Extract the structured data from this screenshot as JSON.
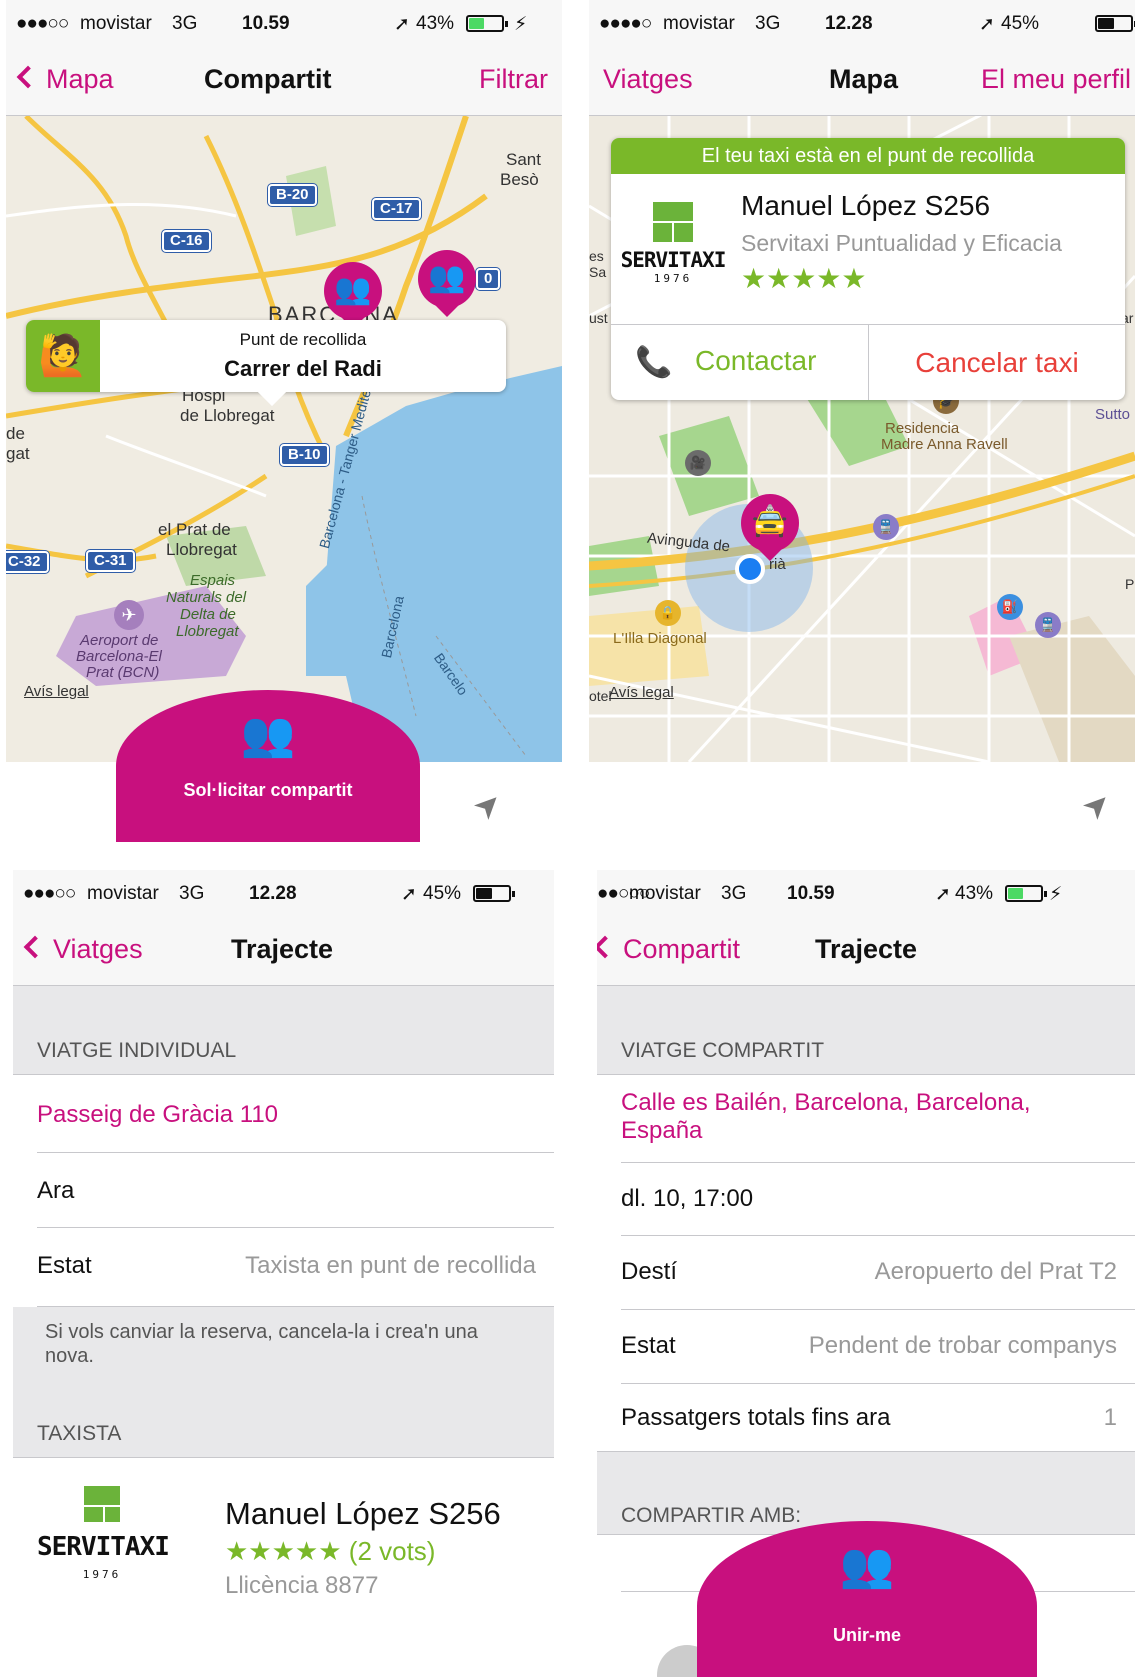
{
  "panel1": {
    "status": {
      "signal": "●●●○○",
      "carrier": "movistar",
      "network": "3G",
      "time": "10.59",
      "battery": "43%"
    },
    "nav": {
      "back": "Mapa",
      "title": "Compartit",
      "right": "Filtrar"
    },
    "map": {
      "labels": {
        "sant": "Sant",
        "beso": "Besò",
        "hosp": "Hospi",
        "de_llobregat": "de Llobregat",
        "de": "de",
        "gat": "gat",
        "prat": "el Prat de",
        "llobregat": "Llobregat",
        "espais": "Espais",
        "naturals": "Naturals del",
        "delta": "Delta de",
        "llob2": "Llobregat",
        "aero1": "Aeroport de",
        "aero2": "Barcelona-El",
        "aero3": "Prat (BCN)",
        "tanger": "Barcelona - Tanger Mediterraneo",
        "barcelona_road": "Barcelona",
        "barcel": "Barcelo",
        "barc_city": "BARC   ONA"
      },
      "roads": {
        "b20": "B-20",
        "c17": "C-17",
        "c16": "C-16",
        "b10": "B-10",
        "c32": "C-32",
        "c31": "C-31",
        "d0": "0"
      },
      "legal": "Avís legal"
    },
    "callout": {
      "caption": "Punt de recollida",
      "street": "Carrer del Radi"
    },
    "action": "Sol·licitar compartit"
  },
  "panel2": {
    "status": {
      "signal": "●●●●○",
      "carrier": "movistar",
      "network": "3G",
      "time": "12.28",
      "battery": "45%"
    },
    "nav": {
      "left": "Viatges",
      "title": "Mapa",
      "right": "El meu perfil"
    },
    "card": {
      "banner": "El teu taxi està en el punt de recollida",
      "driver": "Manuel López S256",
      "company": "Servitaxi Puntualidad y Eficacia",
      "stars": "★★★★★",
      "contact": "Contactar",
      "cancel": "Cancelar taxi"
    },
    "logo": {
      "word": "SERVITAXI",
      "year": "1976"
    },
    "map": {
      "labels": {
        "residencia": "Residencia",
        "madre": "Madre Anna Ravell",
        "sutto": "Sutto",
        "avinguda": "Avinguda de",
        "dia": "rià",
        "illa": "L'Illa Diagonal",
        "es": "es",
        "sa": "Sa",
        "ust": "ust",
        "ar": "ar",
        "p": "P",
        "hotel": "otel"
      },
      "legal": "Avís legal"
    }
  },
  "panel3": {
    "status": {
      "signal": "●●●○○",
      "carrier": "movistar",
      "network": "3G",
      "time": "12.28",
      "battery": "45%"
    },
    "nav": {
      "back": "Viatges",
      "title": "Trajecte"
    },
    "section1": "VIATGE INDIVIDUAL",
    "address": "Passeig de Gràcia 110",
    "when": "Ara",
    "status_label": "Estat",
    "status_value": "Taxista en punt de recollida",
    "note": "Si vols canviar la reserva, cancela-la i crea'n una nova.",
    "section2": "TAXISTA",
    "driver": "Manuel López S256",
    "stars": "★★★★★",
    "votes": "(2 vots)",
    "licence": "Llicència 8877",
    "logo": {
      "word": "SERVITAXI",
      "year": "1976"
    }
  },
  "panel4": {
    "status": {
      "signal": "●●○○○",
      "carrier": "movistar",
      "network": "3G",
      "time": "10.59",
      "battery": "43%"
    },
    "nav": {
      "back": "Compartit",
      "title": "Trajecte"
    },
    "section1": "VIATGE COMPARTIT",
    "address": "Calle es Bailén, Barcelona, Barcelona, España",
    "when": "dl. 10, 17:00",
    "dest_label": "Destí",
    "dest_value": "Aeropuerto del Prat T2",
    "status_label": "Estat",
    "status_value": "Pendent de trobar companys",
    "pass_label": "Passatgers totals fins ara",
    "pass_value": "1",
    "section2": "COMPARTIR AMB:",
    "action": "Unir-me"
  },
  "colors": {
    "accent": "#c8107e",
    "green": "#7ab829",
    "nav": "#f7f7f7",
    "section": "#e8e8ea"
  },
  "icons": {
    "back": "chevron-left-icon",
    "location": "location-arrow-icon",
    "share": "share-people-icon",
    "taxi": "taxi-icon",
    "phone": "phone-icon"
  }
}
